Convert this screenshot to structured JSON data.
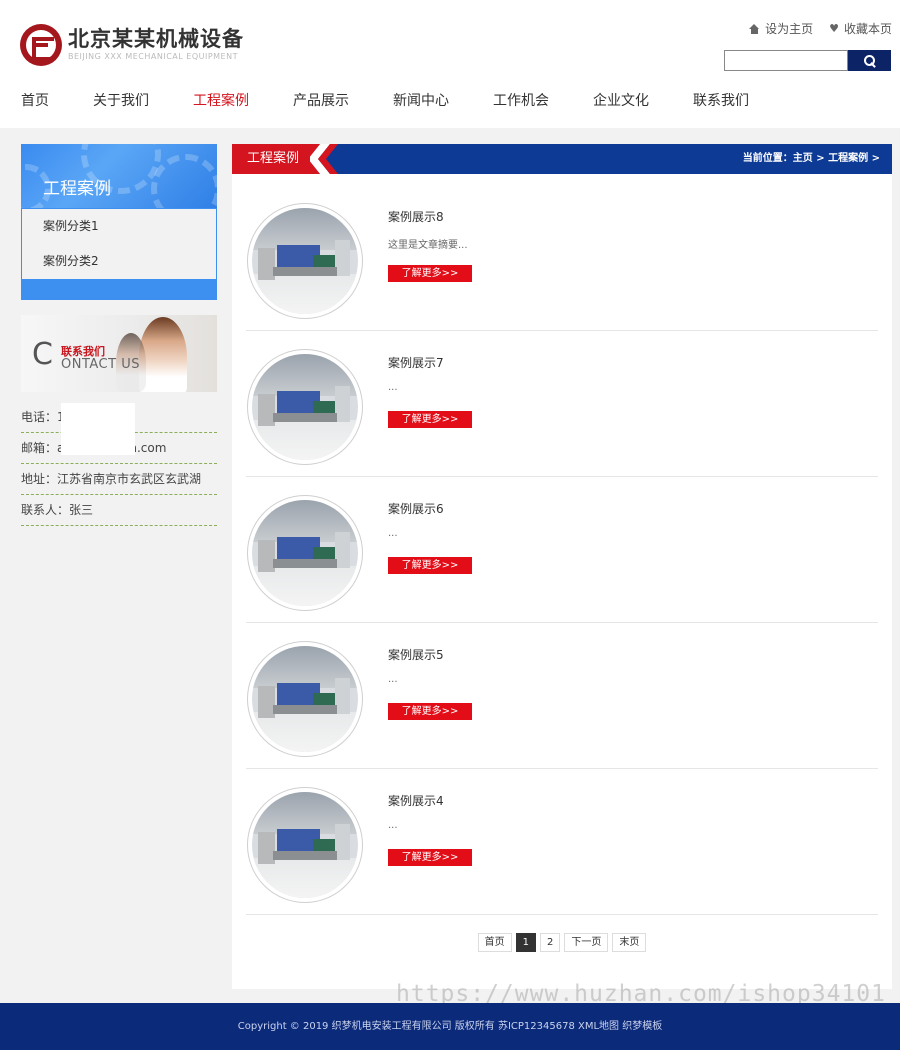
{
  "header": {
    "logo_cn": "北京某某机械设备",
    "logo_en": "BEIJING XXX MECHANICAL EQUIPMENT",
    "set_home": "设为主页",
    "favorite": "收藏本页",
    "search_placeholder": ""
  },
  "nav": {
    "items": [
      {
        "label": "首页"
      },
      {
        "label": "关于我们"
      },
      {
        "label": "工程案例"
      },
      {
        "label": "产品展示"
      },
      {
        "label": "新闻中心"
      },
      {
        "label": "工作机会"
      },
      {
        "label": "企业文化"
      },
      {
        "label": "联系我们"
      }
    ],
    "active": "工程案例"
  },
  "sidebar": {
    "title": "工程案例",
    "categories": [
      {
        "label": "案例分类1"
      },
      {
        "label": "案例分类2"
      }
    ],
    "contact_banner": {
      "cn": "联系我们",
      "en": "ONTACT US",
      "c": "C"
    },
    "contact": {
      "phone": "电话：1",
      "email": "邮箱：a",
      "email_tail": "n.com",
      "address": "地址：江苏省南京市玄武区玄武湖",
      "person": "联系人：张三"
    }
  },
  "content": {
    "title": "工程案例",
    "breadcrumb": "当前位置：主页 > 工程案例 >",
    "items": [
      {
        "title": "案例展示8",
        "desc": "这里是文章摘要...",
        "button": "了解更多>>"
      },
      {
        "title": "案例展示7",
        "desc": "...",
        "button": "了解更多>>"
      },
      {
        "title": "案例展示6",
        "desc": "...",
        "button": "了解更多>>"
      },
      {
        "title": "案例展示5",
        "desc": "...",
        "button": "了解更多>>"
      },
      {
        "title": "案例展示4",
        "desc": "...",
        "button": "了解更多>>"
      }
    ],
    "pager": {
      "first": "首页",
      "pages": [
        "1",
        "2"
      ],
      "current": "1",
      "next": "下一页",
      "last": "末页"
    }
  },
  "watermark": "https://www.huzhan.com/ishop34101",
  "footer": {
    "text": "Copyright © 2019 织梦机电安装工程有限公司 版权所有 苏ICP12345678 XML地图 织梦模板"
  },
  "colors": {
    "brand_red": "#d4141e",
    "nav_blue": "#0c3a94",
    "footer_blue": "#0c2a7a",
    "sidebar_blue": "#3d8ff0",
    "button_red": "#e30d18"
  }
}
